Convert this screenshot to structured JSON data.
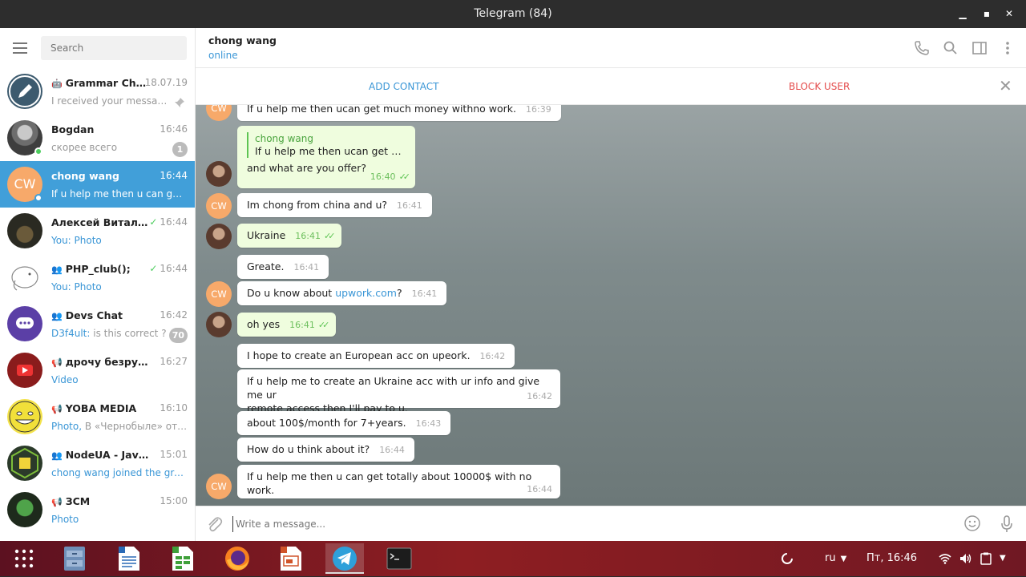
{
  "window": {
    "title": "Telegram (84)",
    "minimize": "▁",
    "maximize": "▪",
    "close": "✕"
  },
  "search": {
    "placeholder": "Search"
  },
  "chats": [
    {
      "name": "Grammar Che...",
      "time": "18.07.19",
      "preview": "I received your message...",
      "pinned": true,
      "type": "bot"
    },
    {
      "name": "Bogdan",
      "time": "16:46",
      "preview": "скорее всего",
      "badge": "1",
      "online": true
    },
    {
      "name": "chong wang",
      "time": "16:44",
      "preview": "If u help me then u can get t...",
      "initials": "CW",
      "active": true,
      "online": true
    },
    {
      "name": "Алексей Витали...",
      "time": "16:44",
      "preview_prefix": "You: ",
      "preview": "Photo",
      "read": true
    },
    {
      "name": "PHP_club();",
      "time": "16:44",
      "preview_prefix": "You: ",
      "preview": "Photo",
      "read": true,
      "type": "group"
    },
    {
      "name": "Devs Chat",
      "time": "16:42",
      "preview_prefix": "D3f4ult: ",
      "preview": "is this correct ?",
      "badge": "70",
      "type": "group"
    },
    {
      "name": "дрочу безруким",
      "time": "16:27",
      "preview": "Video",
      "type": "channel"
    },
    {
      "name": "YOBA MEDIA",
      "time": "16:10",
      "preview_prefix": "Photo, ",
      "preview": "В «Чернобыле» от Н...",
      "type": "channel"
    },
    {
      "name": "NodeUA - JavaScr...",
      "time": "15:01",
      "preview": "chong wang joined the group",
      "type": "group"
    },
    {
      "name": "ЗСМ",
      "time": "15:00",
      "preview": "Photo",
      "type": "channel"
    }
  ],
  "header": {
    "name": "chong wang",
    "status": "online"
  },
  "actionbar": {
    "add_contact": "ADD CONTACT",
    "block_user": "BLOCK USER"
  },
  "messages": [
    {
      "text": "If u help me then ucan get much money withno work.",
      "time": "16:39",
      "out": false
    },
    {
      "reply_name": "chong wang",
      "reply_text": "If u help me then ucan get muc...",
      "text": "and what are you offer?",
      "time": "16:40",
      "out": true
    },
    {
      "text": "Im chong from china and u?",
      "time": "16:41",
      "out": false
    },
    {
      "text": "Ukraine",
      "time": "16:41",
      "out": true
    },
    {
      "text": "Greate.",
      "time": "16:41",
      "out": false
    },
    {
      "text_before": "Do u know about ",
      "link": "upwork.com",
      "text_after": "?",
      "time": "16:41",
      "out": false
    },
    {
      "text": "oh yes",
      "time": "16:41",
      "out": true
    },
    {
      "text": "I hope to create an European acc on upeork.",
      "time": "16:42",
      "out": false
    },
    {
      "line1": "If u help me to create  an Ukraine acc with ur info and give me ur",
      "line2": "remote access then I'll pay to u.",
      "time": "16:42",
      "out": false
    },
    {
      "text": "about 100$/month for 7+years.",
      "time": "16:43",
      "out": false
    },
    {
      "text": "How do u think about it?",
      "time": "16:44",
      "out": false
    },
    {
      "text": "If u help me then u can get totally about 10000$ with no work.",
      "time": "16:44",
      "out": false
    }
  ],
  "compose": {
    "placeholder": "Write a message..."
  },
  "taskbar": {
    "lang": "ru",
    "clock": "Пт, 16:46"
  }
}
